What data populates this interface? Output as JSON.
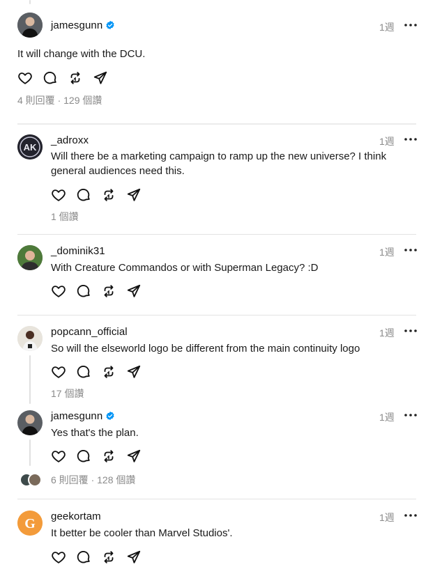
{
  "main_post": {
    "username": "jamesgunn",
    "verified": true,
    "time": "1週",
    "text": "It will change with the DCU.",
    "meta": "4 則回覆 · 129 個讚"
  },
  "replies": [
    {
      "username": "_adroxx",
      "time": "1週",
      "text": "Will there be a marketing campaign to ramp up the new universe? I think general audiences need this.",
      "meta": "1 個讚",
      "avatar_text": "AK"
    },
    {
      "username": "_dominik31",
      "time": "1週",
      "text": "With Creature Commandos or with Superman Legacy? :D",
      "meta": ""
    },
    {
      "username": "popcann_official",
      "time": "1週",
      "text": "So will the elseworld logo be different from the main continuity logo",
      "meta": "17 個讚"
    },
    {
      "username": "jamesgunn",
      "verified": true,
      "time": "1週",
      "text": "Yes that's the plan.",
      "meta": "6 則回覆 · 128 個讚"
    },
    {
      "username": "geekortam",
      "time": "1週",
      "text": "It better be cooler than Marvel Studios'.",
      "meta": "",
      "avatar_text": "G"
    }
  ],
  "colors": {
    "verified_blue": "#0095f6",
    "geekortam_orange": "#f39b3a",
    "muted_text": "#8a8a8a"
  },
  "icons": [
    "heart-icon",
    "comment-icon",
    "repost-icon",
    "share-icon",
    "more-icon",
    "verified-icon"
  ]
}
